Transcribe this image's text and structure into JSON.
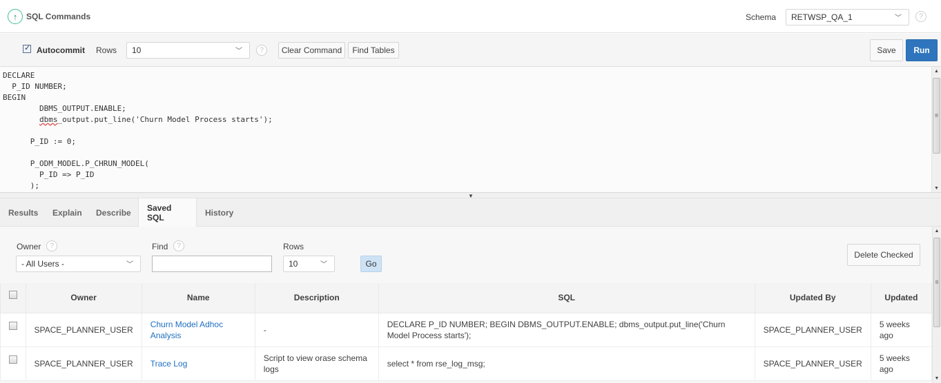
{
  "header": {
    "title": "SQL Commands",
    "schema_label": "Schema",
    "schema_value": "RETWSP_QA_1"
  },
  "toolbar": {
    "autocommit_label": "Autocommit",
    "autocommit_checked": true,
    "rows_label": "Rows",
    "rows_value": "10",
    "clear_command_label": "Clear Command",
    "find_tables_label": "Find Tables",
    "save_label": "Save",
    "run_label": "Run"
  },
  "editor": {
    "lines": [
      "DECLARE",
      "  P_ID NUMBER;",
      "BEGIN",
      "        DBMS_OUTPUT.ENABLE;",
      "        dbms_output.put_line('Churn Model Process starts');",
      "",
      "      P_ID := 0;",
      "",
      "      P_ODM_MODEL.P_CHRUN_MODEL(",
      "        P_ID => P_ID",
      "      );"
    ]
  },
  "tabs": [
    {
      "label": "Results",
      "active": false
    },
    {
      "label": "Explain",
      "active": false
    },
    {
      "label": "Describe",
      "active": false
    },
    {
      "label": "Saved SQL",
      "active": true
    },
    {
      "label": "History",
      "active": false
    }
  ],
  "saved_sql": {
    "owner_label": "Owner",
    "owner_value": "- All Users -",
    "find_label": "Find",
    "find_value": "",
    "rows_label": "Rows",
    "rows_value": "10",
    "go_label": "Go",
    "delete_checked_label": "Delete Checked",
    "columns": [
      "Owner",
      "Name",
      "Description",
      "SQL",
      "Updated By",
      "Updated"
    ],
    "rows": [
      {
        "owner": "SPACE_PLANNER_USER",
        "name": "Churn Model Adhoc Analysis",
        "description": "-",
        "sql": "DECLARE P_ID NUMBER; BEGIN DBMS_OUTPUT.ENABLE; dbms_output.put_line('Churn Model Process starts');",
        "updated_by": "SPACE_PLANNER_USER",
        "updated": "5 weeks ago"
      },
      {
        "owner": "SPACE_PLANNER_USER",
        "name": "Trace Log",
        "description": "Script to view orase schema logs",
        "sql": "select * from rse_log_msg;",
        "updated_by": "SPACE_PLANNER_USER",
        "updated": "5 weeks ago"
      }
    ]
  }
}
